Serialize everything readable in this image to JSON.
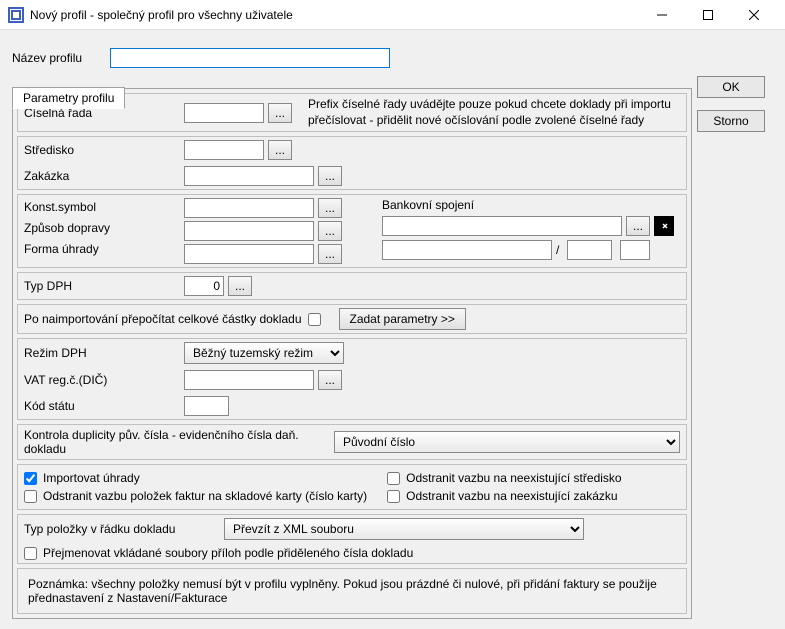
{
  "window": {
    "title": "Nový profil - společný profil pro všechny uživatele"
  },
  "profileName": {
    "label": "Název profilu",
    "value": ""
  },
  "tab": {
    "label": "Parametry profilu"
  },
  "buttons": {
    "ok": "OK",
    "cancel": "Storno",
    "dots": "...",
    "params": "Zadat parametry >>"
  },
  "fields": {
    "ciselna_rada": {
      "label": "Číselná řada",
      "value": "",
      "help": "Prefix číselné řady uvádějte pouze pokud chcete doklady při importu přečíslovat - přidělit nové očíslování podle zvolené číselné řady"
    },
    "stredisko": {
      "label": "Středisko",
      "value": ""
    },
    "zakazka": {
      "label": "Zakázka",
      "value": ""
    },
    "konst_symbol": {
      "label": "Konst.symbol",
      "value": ""
    },
    "zpusob_dopravy": {
      "label": "Způsob dopravy",
      "value": ""
    },
    "forma_uhrady": {
      "label": "Forma úhrady",
      "value": ""
    },
    "bankovni_spojeni": {
      "label": "Bankovní spojení",
      "v1": "",
      "v2": "",
      "v3": "",
      "v4": ""
    },
    "typ_dph": {
      "label": "Typ DPH",
      "value": "0"
    },
    "recalc": {
      "label": "Po naimportování přepočítat celkové částky dokladu"
    },
    "rezim_dph": {
      "label": "Režim DPH",
      "value": "Běžný tuzemský režim"
    },
    "vat_reg": {
      "label": "VAT reg.č.(DIČ)",
      "value": ""
    },
    "kod_statu": {
      "label": "Kód státu",
      "value": ""
    },
    "duplicity": {
      "label": "Kontrola duplicity pův. čísla - evidenčního čísla daň. dokladu",
      "value": "Původní číslo"
    },
    "typ_polozky": {
      "label": "Typ položky v řádku dokladu",
      "value": "Převzít z XML souboru"
    }
  },
  "options": {
    "import_uhrady": {
      "label": "Importovat úhrady",
      "checked": true
    },
    "odstranit_stredisko": {
      "label": "Odstranit vazbu na neexistující středisko",
      "checked": false
    },
    "odstranit_vazbu_karty": {
      "label": "Odstranit vazbu položek faktur na skladové karty (číslo karty)",
      "checked": false
    },
    "odstranit_zakazku": {
      "label": "Odstranit vazbu na neexistující zakázku",
      "checked": false
    },
    "prejmenovat": {
      "label": "Přejmenovat vkládané soubory příloh podle přiděleného čísla dokladu",
      "checked": false
    }
  },
  "note": "Poznámka: všechny položky nemusí být v profilu vyplněny. Pokud jsou prázdné či nulové, při přidání faktury se použije přednastavení z Nastavení/Fakturace"
}
